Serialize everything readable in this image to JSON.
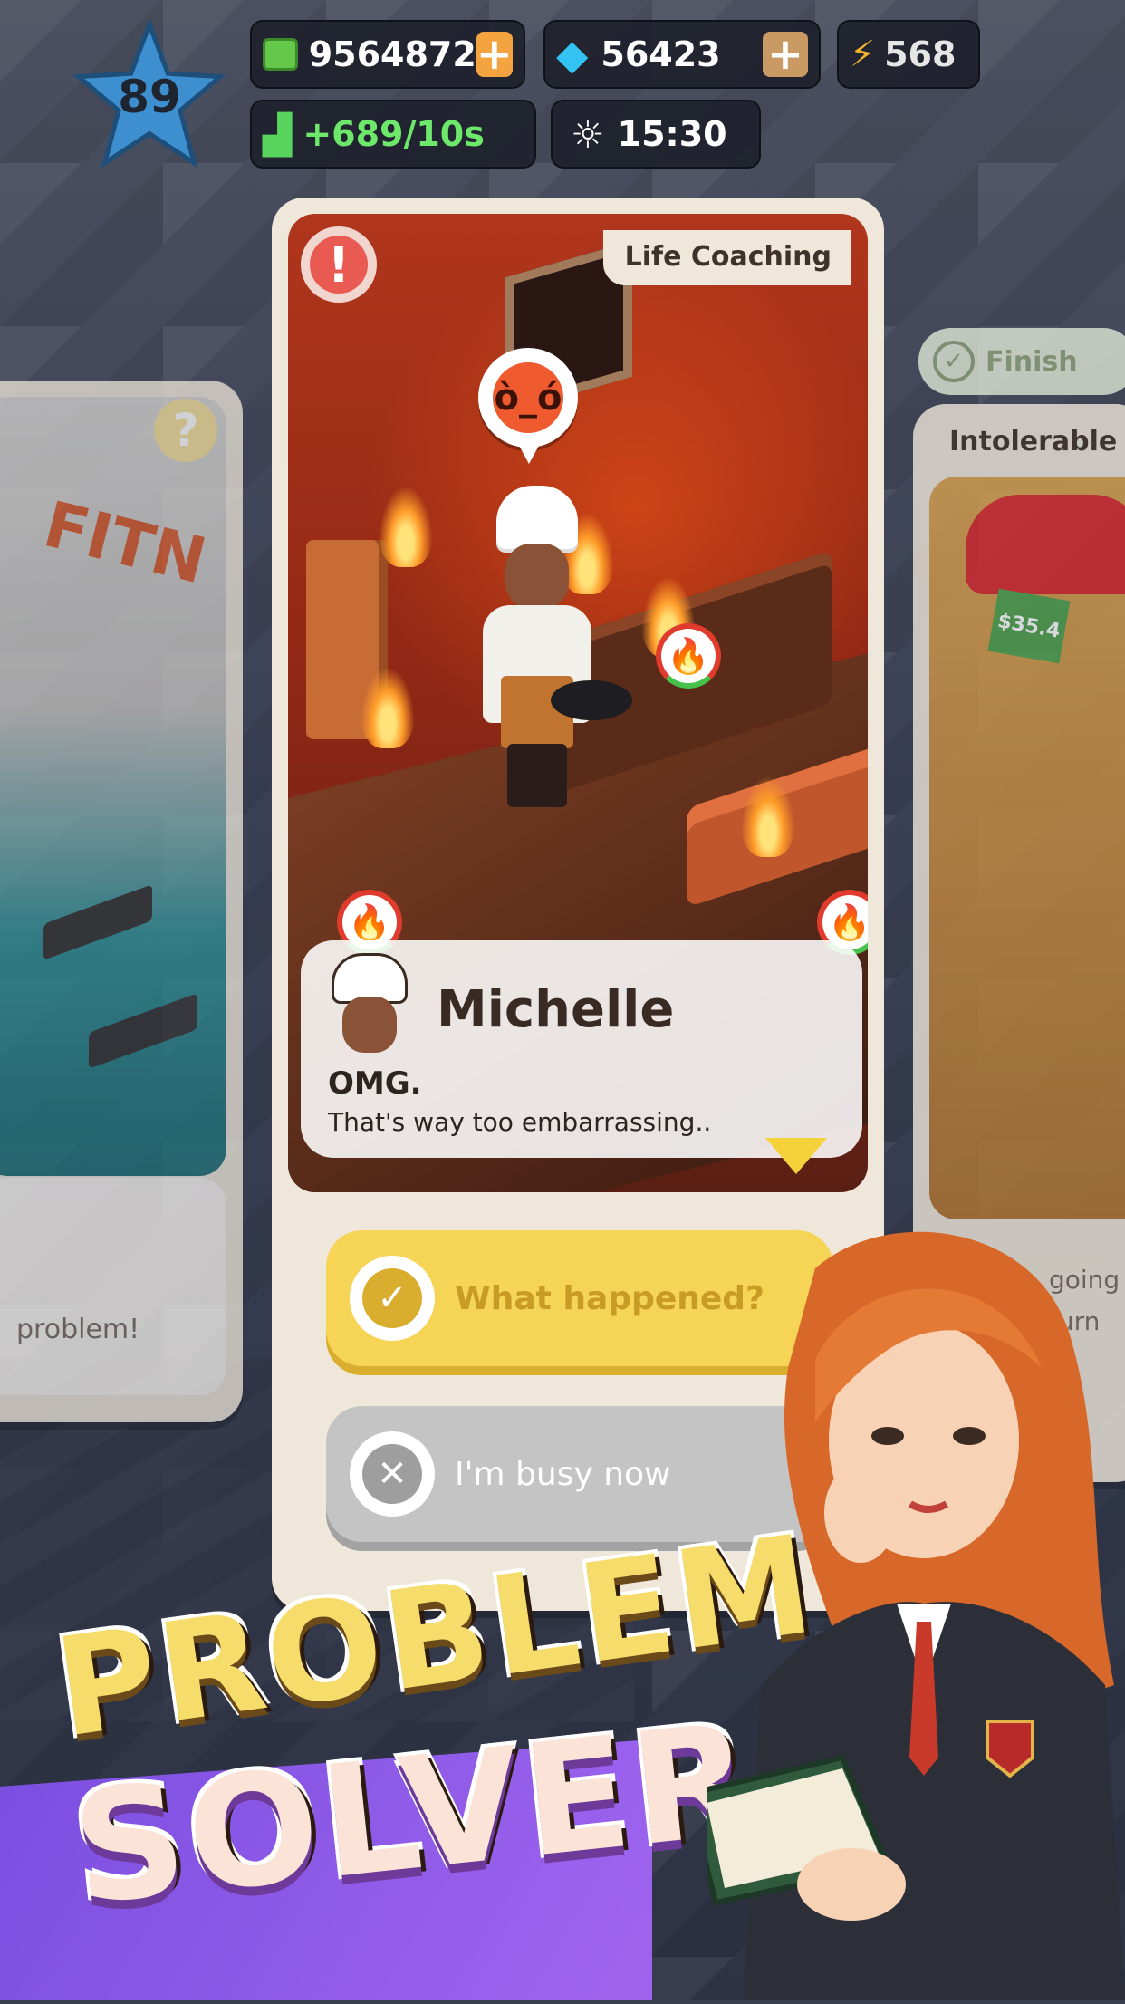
{
  "hud": {
    "level": "89",
    "cash": "9564872",
    "gems": "56423",
    "energy": "568",
    "income_rate": "+689/10s",
    "time": "15:30"
  },
  "cards": {
    "center": {
      "category": "Life Coaching",
      "speaker_name": "Michelle",
      "line1": "OMG.",
      "line2": "That's way too embarrassing..",
      "option_yes": "What happened?",
      "option_no": "I'm busy now"
    },
    "left": {
      "scene_word": "FITN",
      "dialog_text": "problem!"
    },
    "right": {
      "status": "Finish",
      "category": "Intolerable",
      "price_tag": "$35.4",
      "dialog_line1": "going t",
      "dialog_line2": "furn"
    }
  },
  "headline": {
    "line1": "PROBLEM",
    "line2": "SOLVER!"
  },
  "colors": {
    "accent_yellow": "#f6d456",
    "alert_red": "#e85a52",
    "headline_purple": "#7b4ee0"
  }
}
